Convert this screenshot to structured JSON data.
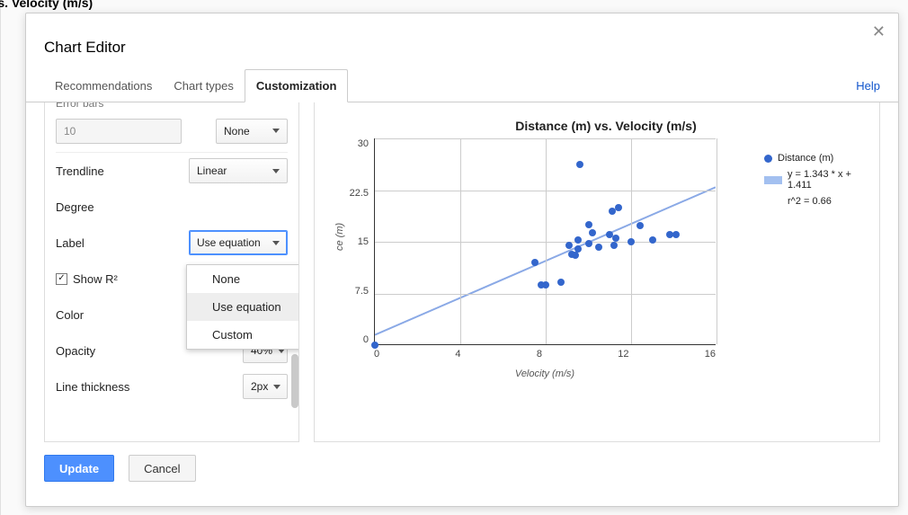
{
  "header": {
    "page_title_fragment": ") vs. Velocity (m/s)",
    "modal_title": "Chart Editor",
    "close_icon": "✕"
  },
  "tabs": {
    "recommendations": "Recommendations",
    "chart_types": "Chart types",
    "customization": "Customization",
    "help": "Help"
  },
  "settings": {
    "error_bars": {
      "label": "Error bars",
      "value": "10",
      "type": "None"
    },
    "trendline": {
      "label": "Trendline",
      "value": "Linear"
    },
    "degree": {
      "label": "Degree"
    },
    "label_field": {
      "label": "Label",
      "value": "Use equation"
    },
    "show_r2": {
      "label": "Show R²",
      "checked": true
    },
    "color": {
      "label": "Color"
    },
    "opacity": {
      "label": "Opacity",
      "value": "40%"
    },
    "line_thickness": {
      "label": "Line thickness",
      "value": "2px"
    },
    "dropdown": {
      "none": "None",
      "use_equation": "Use equation",
      "custom": "Custom"
    }
  },
  "footer": {
    "update": "Update",
    "cancel": "Cancel"
  },
  "chart_data": {
    "type": "scatter",
    "title": "Distance (m) vs. Velocity (m/s)",
    "xlabel": "Velocity (m/s)",
    "ylabel": "Distance (m)",
    "xlim": [
      0,
      16
    ],
    "ylim": [
      0,
      30
    ],
    "x_ticks": [
      0,
      4,
      8,
      12,
      16
    ],
    "y_ticks": [
      0,
      7.5,
      15,
      22.5,
      30
    ],
    "series": [
      {
        "name": "Distance (m)",
        "type": "scatter",
        "points": [
          [
            0,
            0
          ],
          [
            7.5,
            12
          ],
          [
            7.8,
            8.8
          ],
          [
            8,
            8.8
          ],
          [
            8.7,
            9.1
          ],
          [
            9.1,
            14.5
          ],
          [
            9.2,
            13.2
          ],
          [
            9.4,
            13
          ],
          [
            9.5,
            15.3
          ],
          [
            9.5,
            14
          ],
          [
            9.6,
            26.2
          ],
          [
            10,
            14.7
          ],
          [
            10,
            17.5
          ],
          [
            10.2,
            16.3
          ],
          [
            10.5,
            14.2
          ],
          [
            11,
            16
          ],
          [
            11.1,
            19.5
          ],
          [
            11.2,
            14.5
          ],
          [
            11.3,
            15.5
          ],
          [
            11.4,
            20
          ],
          [
            12,
            15
          ],
          [
            12.4,
            17.4
          ],
          [
            13,
            15.2
          ],
          [
            13.8,
            16.1
          ],
          [
            14.1,
            16.1
          ]
        ]
      }
    ],
    "trendline": {
      "slope": 1.343,
      "intercept": 1.411,
      "r2": 0.66,
      "legend_eq": "y = 1.343 * x + 1.411",
      "legend_r2": "r^2 = 0.66"
    },
    "legend_series_label": "Distance (m)"
  }
}
